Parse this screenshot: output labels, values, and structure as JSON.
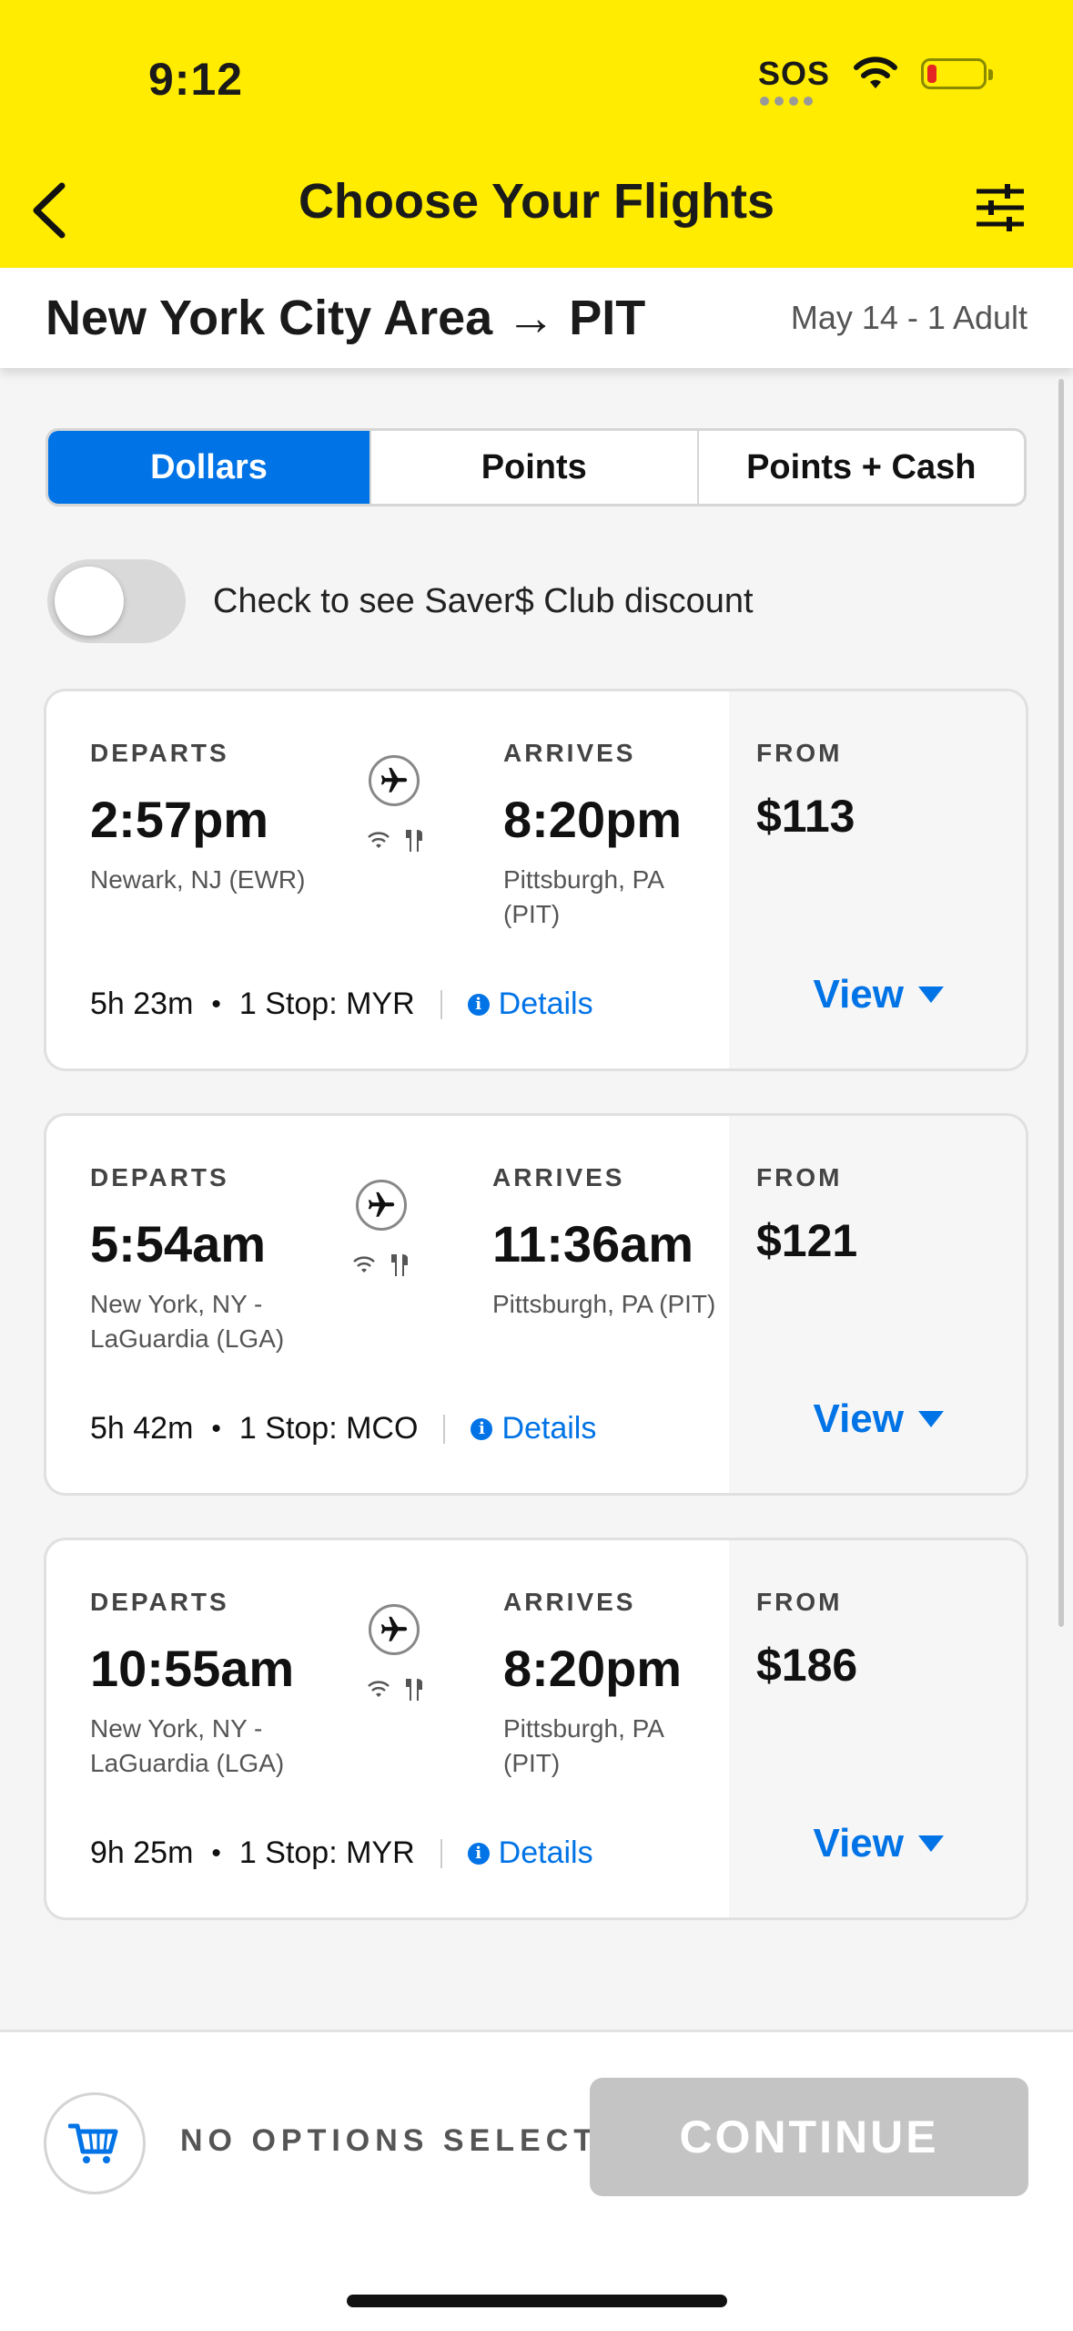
{
  "status": {
    "time": "9:12",
    "sos": "SOS"
  },
  "header": {
    "title": "Choose Your Flights"
  },
  "route": {
    "title": "New York City Area → PIT",
    "date_info": "May 14 - 1 Adult"
  },
  "tabs": [
    {
      "label": "Dollars",
      "active": true
    },
    {
      "label": "Points",
      "active": false
    },
    {
      "label": "Points + Cash",
      "active": false
    }
  ],
  "saver": {
    "label": "Check to see Saver$ Club discount",
    "checked": false
  },
  "labels": {
    "departs": "DEPARTS",
    "arrives": "ARRIVES",
    "from": "FROM",
    "details": "Details",
    "view": "View"
  },
  "flights": [
    {
      "depart_time": "2:57pm",
      "depart_city": "Newark, NJ (EWR)",
      "arrive_time": "8:20pm",
      "arrive_city": "Pittsburgh, PA\n(PIT)",
      "price": "$113",
      "duration": "5h 23m",
      "stops": "1 Stop: MYR"
    },
    {
      "depart_time": "5:54am",
      "depart_city": "New York, NY -\nLaGuardia (LGA)",
      "arrive_time": "11:36am",
      "arrive_city": "Pittsburgh, PA (PIT)",
      "price": "$121",
      "duration": "5h 42m",
      "stops": "1 Stop: MCO"
    },
    {
      "depart_time": "10:55am",
      "depart_city": "New York, NY -\nLaGuardia (LGA)",
      "arrive_time": "8:20pm",
      "arrive_city": "Pittsburgh, PA\n(PIT)",
      "price": "$186",
      "duration": "9h 25m",
      "stops": "1 Stop: MYR"
    }
  ],
  "footer": {
    "status": "NO OPTIONS SELECTED",
    "continue_label": "CONTINUE"
  },
  "colors": {
    "brand_yellow": "#ffec00",
    "accent_blue": "#0073e6",
    "disabled_gray": "#c4c4c4"
  }
}
